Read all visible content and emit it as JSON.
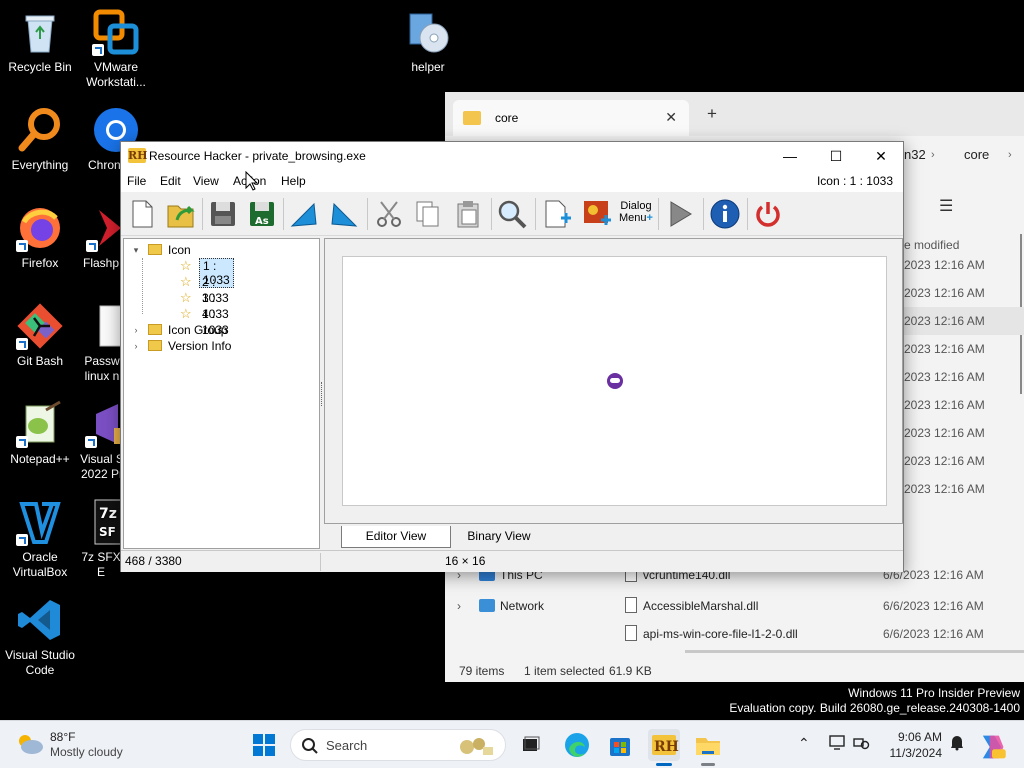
{
  "desktop": {
    "icons": [
      {
        "label": "Recycle Bin"
      },
      {
        "label": "VMware Workstati..."
      },
      {
        "label": "helper"
      },
      {
        "label": "Everything"
      },
      {
        "label": "Chron"
      },
      {
        "label": "Firefox"
      },
      {
        "label": "Flashp"
      },
      {
        "label": "Git Bash"
      },
      {
        "label": "Passw linux n"
      },
      {
        "label": "Notepad++"
      },
      {
        "label": "Visual S 2022 Pr"
      },
      {
        "label": "Oracle VirtualBox"
      },
      {
        "label": "7z SFX E"
      },
      {
        "label": "Visual Studio Code"
      }
    ]
  },
  "explorer": {
    "tab_title": "core",
    "close_glyph": "✕",
    "new_tab_glyph": "+",
    "breadcrumb": [
      "n32",
      "core"
    ],
    "breadcrumb_sep": "›",
    "menu_glyph": "☰",
    "date_modified_header": "e modified",
    "rows": [
      {
        "date": "2023 12:16 AM",
        "selected": false
      },
      {
        "date": "2023 12:16 AM",
        "selected": false
      },
      {
        "date": "2023 12:16 AM",
        "selected": true
      },
      {
        "date": "2023 12:16 AM",
        "selected": false
      },
      {
        "date": "2023 12:16 AM",
        "selected": false
      },
      {
        "date": "2023 12:16 AM",
        "selected": false
      },
      {
        "date": "2023 12:16 AM",
        "selected": false
      },
      {
        "date": "2023 12:16 AM",
        "selected": false
      },
      {
        "date": "2023 12:16 AM",
        "selected": false
      }
    ],
    "nav": [
      {
        "chevron": "›",
        "label": "This PC",
        "file": "vcruntime140.dll",
        "date": "6/6/2023 12:16 AM"
      },
      {
        "chevron": "›",
        "label": "Network",
        "file": "AccessibleMarshal.dll",
        "date": "6/6/2023 12:16 AM"
      },
      {
        "chevron": "",
        "label": "",
        "file": "api-ms-win-core-file-l1-2-0.dll",
        "date": "6/6/2023 12:16 AM"
      }
    ],
    "status_items": "79 items",
    "status_selected": "1 item selected",
    "status_size": "61.9 KB"
  },
  "rh": {
    "app_icon_text": "RH",
    "title": "Resource Hacker - private_browsing.exe",
    "window_buttons": {
      "minimize": "—",
      "maximize": "☐",
      "close": "✕"
    },
    "menu": [
      "File",
      "Edit",
      "View",
      "Action",
      "Help"
    ],
    "icon_info": "Icon : 1 : 1033",
    "toolbar": {
      "dialog_menu_line1": "Dialog",
      "dialog_menu_line2": "Menu"
    },
    "tree": {
      "expander_open": "▾",
      "expander_closed": "›",
      "star": "☆",
      "icon_folder": "Icon",
      "icon_items": [
        "1 : 1033",
        "2 : 1033",
        "3 : 1033",
        "4 : 1033"
      ],
      "icon_group": "Icon Group",
      "version_info": "Version Info"
    },
    "view_tabs": [
      "Editor View",
      "Binary View"
    ],
    "status_left": "468 / 3380",
    "status_mid": "16 × 16"
  },
  "watermark": {
    "line1": "Windows 11 Pro Insider Preview",
    "line2": "Evaluation copy. Build 26080.ge_release.240308-1400"
  },
  "taskbar": {
    "weather_temp": "88°F",
    "weather_desc": "Mostly cloudy",
    "search_placeholder": "Search",
    "tray_chevron": "⌃",
    "time": "9:06 AM",
    "date": "11/3/2024"
  },
  "colors": {
    "accent": "#0067c0",
    "rh_title_bg": "#ffffff",
    "explorer_bg": "#f3f3f3",
    "taskbar_bg": "#eef1f6"
  }
}
